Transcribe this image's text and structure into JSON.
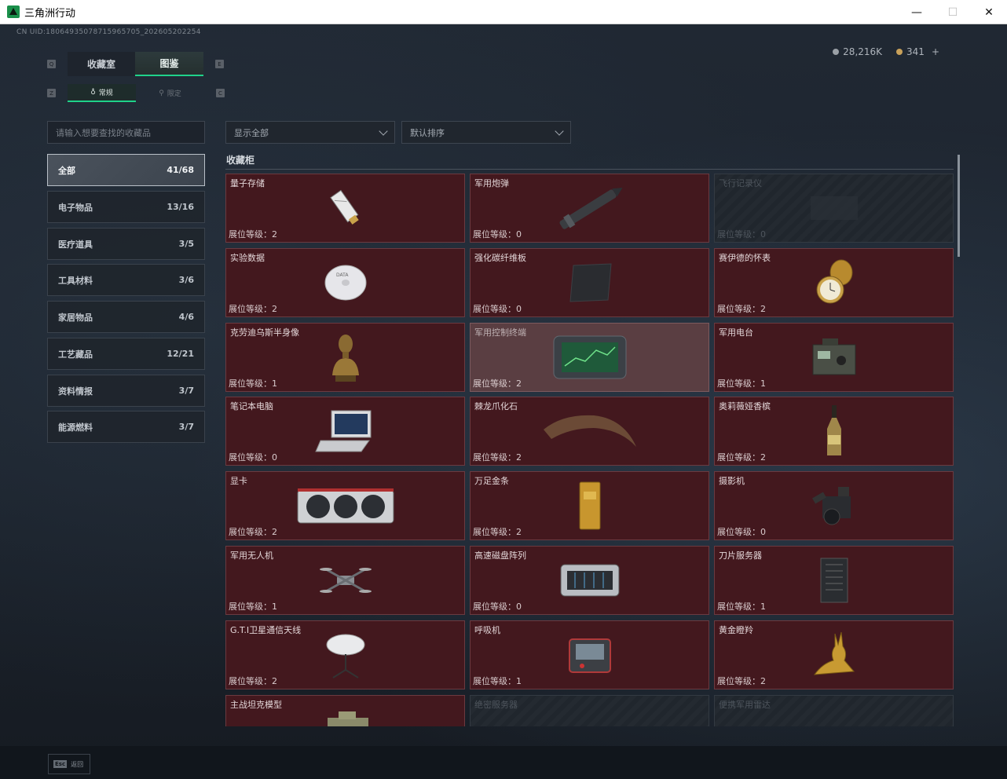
{
  "window": {
    "title": "三角洲行动",
    "minimize": "—",
    "maximize": "☐",
    "close": "✕"
  },
  "uid": "CN UID:18064935078715965705_202605202254",
  "currency": {
    "coins": "28,216K",
    "gems": "341",
    "plus": "+"
  },
  "tabs": [
    {
      "label": "收藏室"
    },
    {
      "label": "图鉴"
    }
  ],
  "key_hints": {
    "q": "Q",
    "e": "E",
    "z": "Z",
    "c": "C"
  },
  "subtabs": [
    {
      "label": "常规",
      "icon": "♁"
    },
    {
      "label": "限定",
      "icon": "⚲"
    }
  ],
  "search": {
    "placeholder": "请输入想要查找的收藏品"
  },
  "categories": [
    {
      "label": "全部",
      "count": "41/68"
    },
    {
      "label": "电子物品",
      "count": "13/16"
    },
    {
      "label": "医疗道具",
      "count": "3/5"
    },
    {
      "label": "工具材料",
      "count": "3/6"
    },
    {
      "label": "家居物品",
      "count": "4/6"
    },
    {
      "label": "工艺藏品",
      "count": "12/21"
    },
    {
      "label": "资料情报",
      "count": "3/7"
    },
    {
      "label": "能源燃料",
      "count": "3/7"
    }
  ],
  "filters": {
    "display": "显示全部",
    "sort": "默认排序"
  },
  "section_title": "收藏柜",
  "items": [
    {
      "name": "量子存储",
      "level": "展位等级：2",
      "icon": "usb-drive-icon"
    },
    {
      "name": "军用炮弹",
      "level": "展位等级：0",
      "icon": "artillery-shell-icon"
    },
    {
      "name": "飞行记录仪",
      "level": "展位等级：0",
      "icon": "flight-recorder-icon"
    },
    {
      "name": "实验数据",
      "level": "展位等级：2",
      "icon": "disc-icon"
    },
    {
      "name": "强化碳纤维板",
      "level": "展位等级：0",
      "icon": "carbon-plate-icon"
    },
    {
      "name": "赛伊德的怀表",
      "level": "展位等级：2",
      "icon": "pocket-watch-icon"
    },
    {
      "name": "克劳迪乌斯半身像",
      "level": "展位等级：1",
      "icon": "bust-icon"
    },
    {
      "name": "军用控制终端",
      "level": "展位等级：2",
      "icon": "control-terminal-icon"
    },
    {
      "name": "军用电台",
      "level": "展位等级：1",
      "icon": "radio-icon"
    },
    {
      "name": "笔记本电脑",
      "level": "展位等级：0",
      "icon": "laptop-icon"
    },
    {
      "name": "棘龙爪化石",
      "level": "展位等级：2",
      "icon": "claw-fossil-icon"
    },
    {
      "name": "奥莉薇娅香槟",
      "level": "展位等级：2",
      "icon": "champagne-icon"
    },
    {
      "name": "显卡",
      "level": "展位等级：2",
      "icon": "graphics-card-icon"
    },
    {
      "name": "万足金条",
      "level": "展位等级：2",
      "icon": "gold-bar-icon"
    },
    {
      "name": "摄影机",
      "level": "展位等级：0",
      "icon": "camera-icon"
    },
    {
      "name": "军用无人机",
      "level": "展位等级：1",
      "icon": "drone-icon"
    },
    {
      "name": "高速磁盘阵列",
      "level": "展位等级：0",
      "icon": "disk-array-icon"
    },
    {
      "name": "刀片服务器",
      "level": "展位等级：1",
      "icon": "blade-server-icon"
    },
    {
      "name": "G.T.I卫星通信天线",
      "level": "展位等级：2",
      "icon": "satellite-dish-icon"
    },
    {
      "name": "呼吸机",
      "level": "展位等级：1",
      "icon": "ventilator-icon"
    },
    {
      "name": "黄金瞪羚",
      "level": "展位等级：2",
      "icon": "gold-gazelle-icon"
    },
    {
      "name": "主战坦克模型",
      "level": "",
      "icon": "tank-model-icon"
    },
    {
      "name": "绝密服务器",
      "level": "",
      "icon": "server-icon"
    },
    {
      "name": "便携军用雷达",
      "level": "",
      "icon": "radar-icon"
    }
  ],
  "bottom": {
    "esc_key": "Esc",
    "esc_label": "返回"
  }
}
